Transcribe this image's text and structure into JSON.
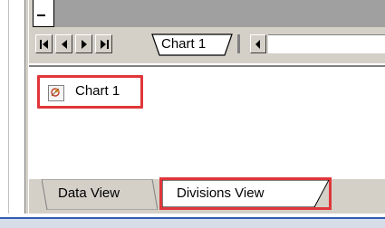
{
  "sheet_tab": {
    "label": "Chart 1"
  },
  "tree": {
    "items": [
      {
        "label": "Chart 1",
        "icon": "chart-icon"
      }
    ]
  },
  "view_tabs": [
    {
      "label": "Data View",
      "selected": false
    },
    {
      "label": "Divisions View",
      "selected": true
    }
  ],
  "navigation": {
    "buttons": [
      "first-sheet-icon",
      "previous-sheet-icon",
      "next-sheet-icon",
      "last-sheet-icon"
    ],
    "scroll": "scroll-left-icon"
  },
  "colors": {
    "highlight": "#e0363a",
    "face": "#d4d0c8",
    "window": "#ffffff",
    "taskbar": "#2f5bb7"
  }
}
